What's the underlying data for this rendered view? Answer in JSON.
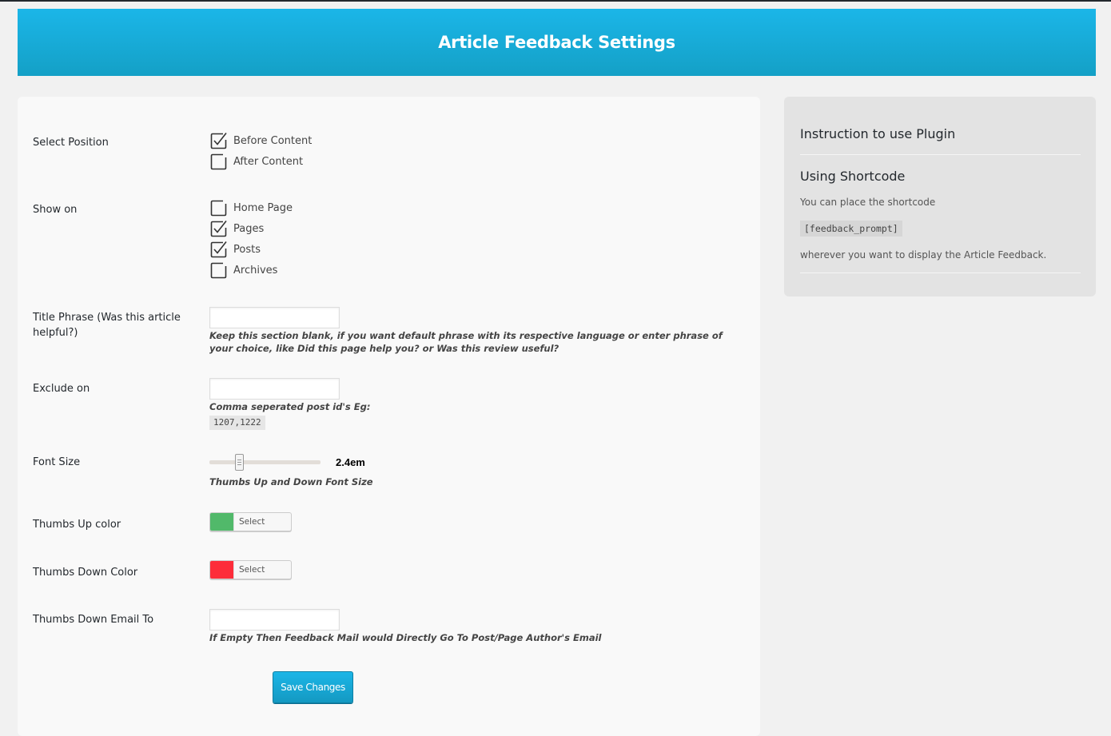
{
  "header": {
    "title": "Article Feedback Settings"
  },
  "form": {
    "select_position": {
      "label": "Select Position",
      "options": [
        {
          "label": "Before Content",
          "checked": true
        },
        {
          "label": "After Content",
          "checked": false
        }
      ]
    },
    "show_on": {
      "label": "Show on",
      "options": [
        {
          "label": "Home Page",
          "checked": false
        },
        {
          "label": "Pages",
          "checked": true
        },
        {
          "label": "Posts",
          "checked": true
        },
        {
          "label": "Archives",
          "checked": false
        }
      ]
    },
    "title_phrase": {
      "label": "Title Phrase (Was this article helpful?)",
      "value": "",
      "placeholder": "",
      "description": "Keep this section blank, if you want default phrase with its respective language or enter phrase of your choice, like Did this page help you? or Was this review useful?"
    },
    "exclude_on": {
      "label": "Exclude on",
      "value": "",
      "placeholder": "",
      "description": "Comma seperated post id's Eg:",
      "example_code": "1207,1222"
    },
    "font_size": {
      "label": "Font Size",
      "value_text": "2.4em",
      "slider_fraction": 0.27,
      "description": "Thumbs Up and Down Font Size"
    },
    "thumbs_up_color": {
      "label": "Thumbs Up color",
      "color": "#51b96a",
      "button_label": "Select Color"
    },
    "thumbs_down_color": {
      "label": "Thumbs Down Color",
      "color": "#fd2d3a",
      "button_label": "Select Color"
    },
    "thumbs_down_email": {
      "label": "Thumbs Down Email To",
      "value": "",
      "placeholder": "",
      "description": "If Empty Then Feedback Mail would Directly Go To Post/Page Author's Email"
    },
    "save_label": "Save Changes"
  },
  "sidebar": {
    "title": "Instruction to use Plugin",
    "subtitle": "Using Shortcode",
    "text_before": "You can place the shortcode",
    "shortcode": "[feedback_prompt]",
    "text_after": "wherever you want to display the Article Feedback."
  },
  "colors": {
    "header_top": "#1bb6e8",
    "header_bottom": "#14a0c6",
    "accent": "#1bb6e8"
  }
}
